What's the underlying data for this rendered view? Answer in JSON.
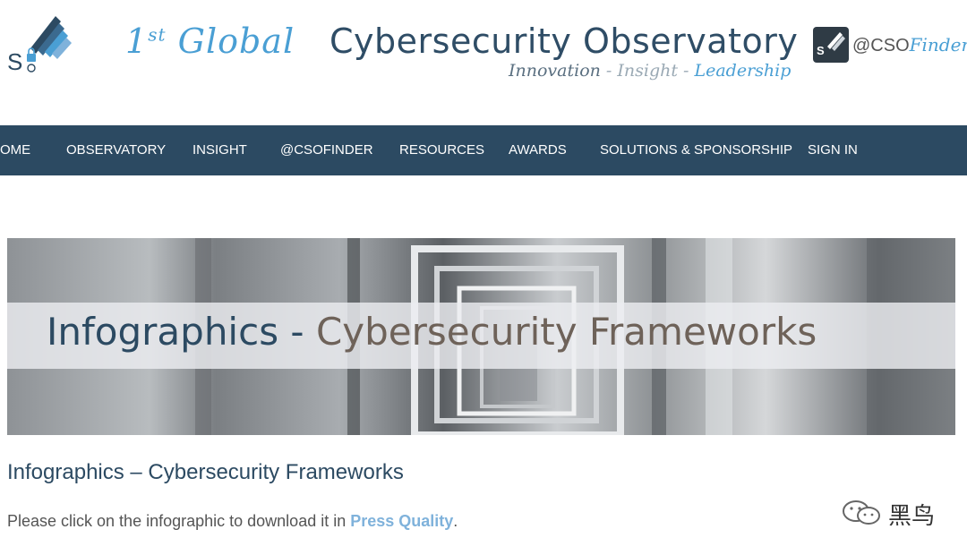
{
  "header": {
    "logo_letters": "S",
    "first_global_main": "1",
    "first_global_sup": "st",
    "first_global_word": "Global",
    "site_title": "Cybersecurity Observatory",
    "motto": {
      "innovation": "Innovation",
      "sep1": " - ",
      "insight": "Insight",
      "sep2": " - ",
      "leadership": "Leadership"
    },
    "csofinder": {
      "badge_text": "S",
      "at_cso": "@CSO",
      "finder": "Finder"
    }
  },
  "nav": {
    "items": [
      {
        "label": "OME"
      },
      {
        "label": "OBSERVATORY"
      },
      {
        "label": "INSIGHT"
      },
      {
        "label": "@CSOFINDER"
      },
      {
        "label": "RESOURCES"
      },
      {
        "label": "AWARDS"
      },
      {
        "label": "SOLUTIONS & SPONSORSHIP"
      },
      {
        "label": "SIGN IN"
      }
    ]
  },
  "banner": {
    "title_part1": "Infographics - ",
    "title_part2": "Cybersecurity Frameworks"
  },
  "content": {
    "heading": "Infographics – Cybersecurity Frameworks",
    "text_before": "Please click on the infographic to download it in ",
    "link_text": "Press Quality",
    "text_after": "."
  },
  "watermark": {
    "text": "黑鸟"
  },
  "colors": {
    "nav_bg": "#2c4a62",
    "accent_blue": "#4a9fd4",
    "link": "#7fb2db",
    "title_dark": "#2f4d66"
  }
}
